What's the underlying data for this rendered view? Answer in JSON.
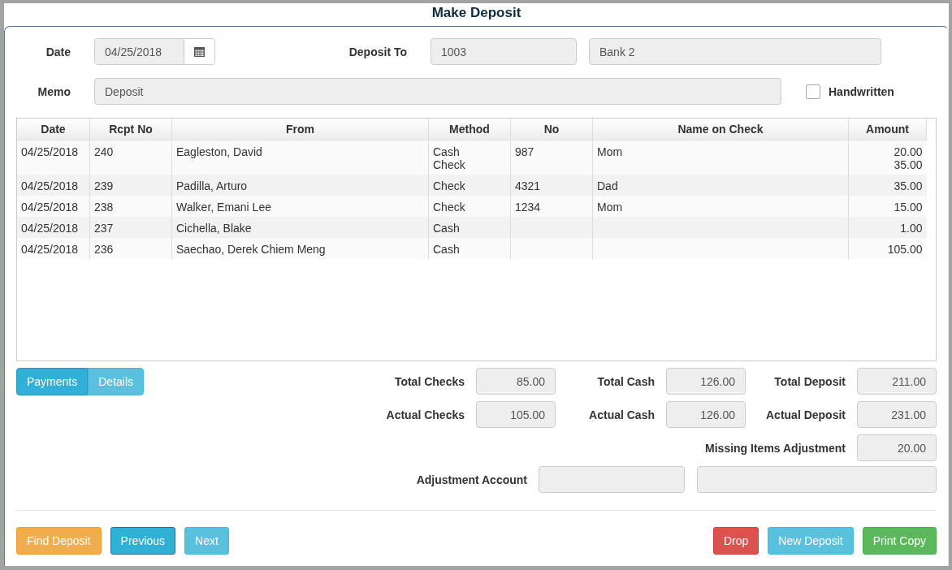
{
  "window": {
    "title": "Make Deposit"
  },
  "form": {
    "date_label": "Date",
    "date": "04/25/2018",
    "deposit_to_label": "Deposit To",
    "account_number": "1003",
    "account_name": "Bank 2",
    "memo_label": "Memo",
    "memo": "Deposit",
    "handwritten": {
      "label": "Handwritten",
      "checked": false
    }
  },
  "table": {
    "columns": [
      "Date",
      "Rcpt No",
      "From",
      "Method",
      "No",
      "Name on Check",
      "Amount"
    ],
    "rows": [
      {
        "date": "04/25/2018",
        "rcpt_no": "240",
        "from": "Eagleston, David",
        "method": [
          "Cash",
          "Check"
        ],
        "no": "987",
        "name_on_check": "Mom",
        "amount": [
          "20.00",
          "35.00"
        ]
      },
      {
        "date": "04/25/2018",
        "rcpt_no": "239",
        "from": "Padilla, Arturo",
        "method": [
          "Check"
        ],
        "no": "4321",
        "name_on_check": "Dad",
        "amount": [
          "35.00"
        ]
      },
      {
        "date": "04/25/2018",
        "rcpt_no": "238",
        "from": "Walker, Emani Lee",
        "method": [
          "Check"
        ],
        "no": "1234",
        "name_on_check": "Mom",
        "amount": [
          "15.00"
        ]
      },
      {
        "date": "04/25/2018",
        "rcpt_no": "237",
        "from": "Cichella, Blake",
        "method": [
          "Cash"
        ],
        "no": "",
        "name_on_check": "",
        "amount": [
          "1.00"
        ]
      },
      {
        "date": "04/25/2018",
        "rcpt_no": "236",
        "from": "Saechao, Derek Chiem Meng",
        "method": [
          "Cash"
        ],
        "no": "",
        "name_on_check": "",
        "amount": [
          "105.00"
        ]
      }
    ]
  },
  "view_toggle": [
    {
      "label": "Payments",
      "selected": true
    },
    {
      "label": "Details",
      "selected": false
    }
  ],
  "totals": [
    {
      "label": "Total Checks",
      "value": "85.00"
    },
    {
      "label": "Total Cash",
      "value": "126.00"
    },
    {
      "label": "Total Deposit",
      "value": "211.00"
    },
    {
      "label": "Actual Checks",
      "value": "105.00"
    },
    {
      "label": "Actual Cash",
      "value": "126.00"
    },
    {
      "label": "Actual Deposit",
      "value": "231.00"
    }
  ],
  "missing_items_adjustment": {
    "label": "Missing Items Adjustment",
    "value": "20.00"
  },
  "adjustment_account": {
    "label": "Adjustment Account"
  },
  "buttons_left": [
    {
      "label": "Find Deposit",
      "kind": "warning"
    },
    {
      "label": "Previous",
      "kind": "primary"
    },
    {
      "label": "Next",
      "kind": "info"
    }
  ],
  "buttons_right": [
    {
      "label": "Drop",
      "kind": "danger"
    },
    {
      "label": "New Deposit",
      "kind": "info"
    },
    {
      "label": "Print Copy",
      "kind": "success"
    }
  ]
}
